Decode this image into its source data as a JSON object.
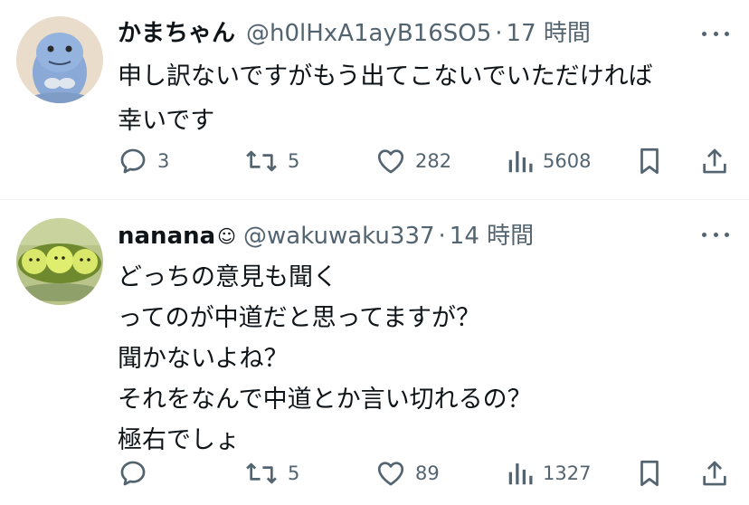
{
  "posts": [
    {
      "display_name": "かまちゃん",
      "name_emoji": "",
      "handle": "@h0lHxA1ayB16SO5",
      "separator": "·",
      "time": "17 時間",
      "body_lines": [
        "申し訳ないですがもう出てこないでいただければ",
        "幸いです"
      ],
      "avatar": "quagsire-avatar",
      "actions": {
        "reply_count": "3",
        "repost_count": "5",
        "like_count": "282",
        "view_count": "5608"
      }
    },
    {
      "display_name": "nanana",
      "name_emoji": "☺",
      "handle": "@wakuwaku337",
      "separator": "·",
      "time": "14 時間",
      "body_lines": [
        "どっちの意見も聞く",
        "ってのが中道だと思ってますが？",
        "聞かないよね？",
        "それをなんで中道とか言い切れるの？",
        "極右でしょ"
      ],
      "avatar": "green-peas-avatar",
      "actions": {
        "reply_count": "",
        "repost_count": "5",
        "like_count": "89",
        "view_count": "1327"
      }
    }
  ],
  "icons": {
    "reply": "reply-icon",
    "repost": "repost-icon",
    "like": "heart-icon",
    "views": "views-icon",
    "bookmark": "bookmark-icon",
    "share": "share-icon",
    "more": "more-icon"
  },
  "colors": {
    "text": "#0f1419",
    "secondary": "#536471",
    "divider": "#eff3f4"
  }
}
